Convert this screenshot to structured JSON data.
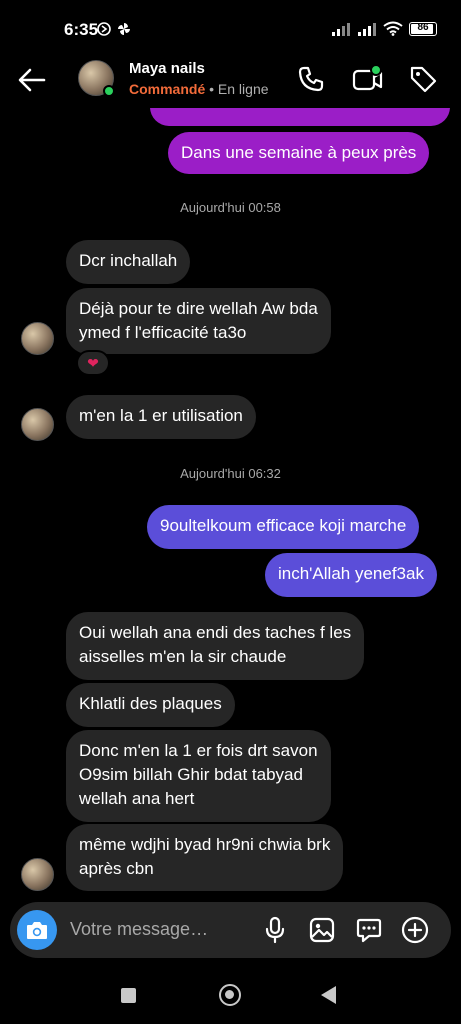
{
  "status_bar": {
    "time": "6:35",
    "battery": "86"
  },
  "header": {
    "name": "Maya nails",
    "order_status": "Commandé",
    "separator": " • ",
    "presence": "En ligne",
    "icons": [
      "back-arrow-icon",
      "phone-icon",
      "video-icon",
      "tag-icon"
    ]
  },
  "messages": [
    {
      "dir": "out",
      "color": "purple",
      "text": "Dans une semaine à peux près"
    },
    {
      "type": "timestamp",
      "text": "Aujourd'hui 00:58"
    },
    {
      "dir": "in",
      "text": "Dcr inchallah"
    },
    {
      "dir": "in",
      "text": "Déjà pour te dire wellah Aw bda ymed f l'efficacité ta3o",
      "reaction": "❤"
    },
    {
      "dir": "in",
      "text": "m'en la 1 er utilisation"
    },
    {
      "type": "timestamp",
      "text": "Aujourd'hui 06:32"
    },
    {
      "dir": "out",
      "color": "blue",
      "text": "9oultelkoum efficace koji marche"
    },
    {
      "dir": "out",
      "color": "blue",
      "text": "inch'Allah yenef3ak"
    },
    {
      "dir": "in",
      "text": "Oui wellah ana endi des taches f les aisselles m'en la sir chaude"
    },
    {
      "dir": "in",
      "text": "Khlatli des plaques"
    },
    {
      "dir": "in",
      "text": "Donc m'en la 1 er fois drt savon O9sim billah Ghir bdat tabyad wellah ana hert"
    },
    {
      "dir": "in",
      "text": "même wdjhi byad hr9ni chwia brk après cbn"
    }
  ],
  "bubbles": {
    "m1": "Dans une semaine à peux près",
    "ts1": "Aujourd'hui 00:58",
    "m2": "Dcr inchallah",
    "m3_l1": "Déjà pour te dire wellah Aw bda",
    "m3_l2": "ymed f l'efficacité ta3o",
    "reaction": "❤",
    "m4": "m'en la 1 er utilisation",
    "ts2": "Aujourd'hui 06:32",
    "m5": "9oultelkoum efficace koji marche",
    "m6": "inch'Allah yenef3ak",
    "m7_l1": "Oui wellah ana endi des taches f les",
    "m7_l2": "aisselles m'en la sir chaude",
    "m8": "Khlatli des plaques",
    "m9_l1": "Donc m'en la 1 er fois drt savon",
    "m9_l2": "O9sim billah Ghir bdat tabyad",
    "m9_l3": "wellah ana hert",
    "m10_l1": "même wdjhi byad hr9ni chwia brk",
    "m10_l2": "après cbn"
  },
  "composer": {
    "placeholder": "Votre message…",
    "icons": [
      "camera-icon",
      "microphone-icon",
      "gallery-icon",
      "sticker-icon",
      "add-icon"
    ]
  },
  "colors": {
    "background": "#000000",
    "incoming_bubble": "#262626",
    "outgoing_purple": "#9b1ec7",
    "outgoing_blue": "#5b4ed9",
    "accent_blue": "#3797f0",
    "online_green": "#2bd15d",
    "order_orange": "#f26b3a"
  }
}
